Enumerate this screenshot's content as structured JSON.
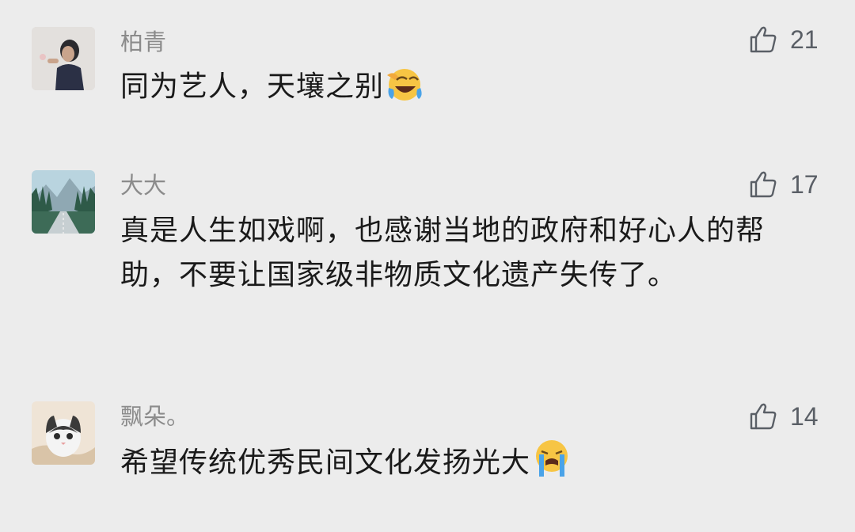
{
  "comments": [
    {
      "username": "柏青",
      "text": "同为艺人，天壤之别",
      "likes": "21",
      "emoji": "face-with-tears-of-joy"
    },
    {
      "username": "大大",
      "text": "真是人生如戏啊，也感谢当地的政府和好心人的帮助，不要让国家级非物质文化遗产失传了。",
      "likes": "17"
    },
    {
      "username": "飘朵。",
      "text": "希望传统优秀民间文化发扬光大",
      "likes": "14",
      "emoji": "loudly-crying-face"
    }
  ],
  "colors": {
    "background": "#ececec",
    "username": "#8b8b8b",
    "text": "#1a1a1a",
    "like": "#5a5f66"
  }
}
